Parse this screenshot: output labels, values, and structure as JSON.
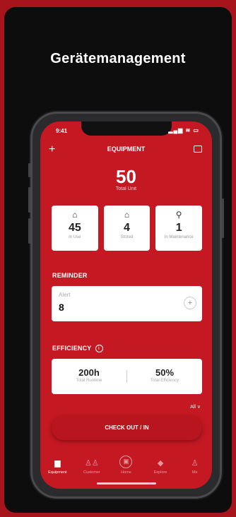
{
  "headline": "Gerätemanagement",
  "status": {
    "time": "9:41",
    "icons": "▂▄▆ ≋ ▭"
  },
  "topbar": {
    "plus": "+",
    "title": "EQUIPMENT"
  },
  "total": {
    "value": "50",
    "label": "Total Unit"
  },
  "cards": [
    {
      "icon": "⌂",
      "value": "45",
      "label": "In Use"
    },
    {
      "icon": "⌂",
      "value": "4",
      "label": "Stored"
    },
    {
      "icon": "⚲",
      "value": "1",
      "label": "In Maintenance"
    }
  ],
  "reminder": {
    "title": "REMINDER",
    "label": "Alert",
    "value": "8",
    "plus": "+"
  },
  "efficiency": {
    "title": "EFFICIENCY",
    "info": "i",
    "items": [
      {
        "value": "200h",
        "label": "Total Runtime"
      },
      {
        "value": "50%",
        "label": "Total Efficiency"
      }
    ],
    "filter": "All ∨"
  },
  "checkout": "CHECK OUT / IN",
  "tabs": [
    {
      "icon": "▆",
      "label": "Equipment"
    },
    {
      "icon": "♙♙",
      "label": "Customer"
    },
    {
      "icon": "▣",
      "label": "Home"
    },
    {
      "icon": "◆",
      "label": "Explore"
    },
    {
      "icon": "♙",
      "label": "Me"
    }
  ],
  "colors": {
    "brand": "#c41822",
    "background": "#a8141c",
    "panel": "#0d0d0d"
  }
}
